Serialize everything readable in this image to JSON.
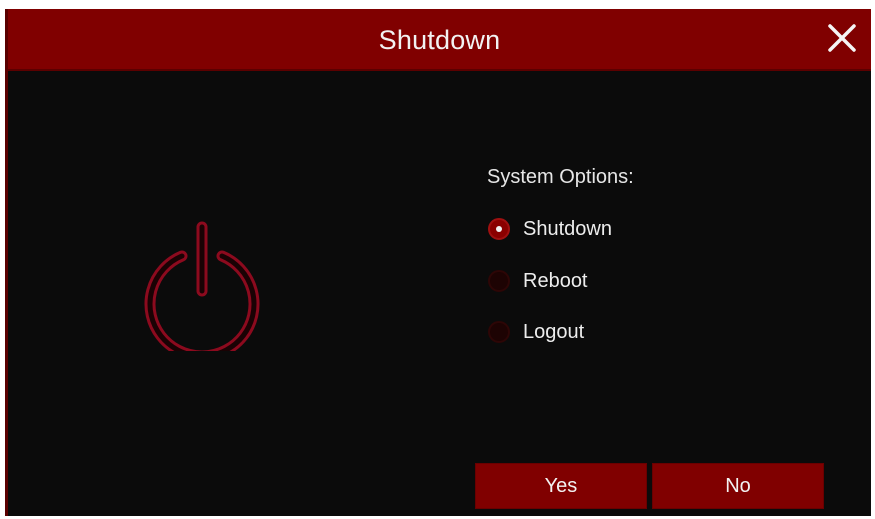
{
  "dialog": {
    "title": "Shutdown"
  },
  "options": {
    "label": "System Options:",
    "items": [
      {
        "label": "Shutdown",
        "selected": true
      },
      {
        "label": "Reboot",
        "selected": false
      },
      {
        "label": "Logout",
        "selected": false
      }
    ]
  },
  "buttons": {
    "yes_label": "Yes",
    "no_label": "No"
  },
  "colors": {
    "titlebar": "#800000",
    "background": "#0b0b0b",
    "button": "#800000",
    "radio_selected": "#8a0000",
    "power_icon": "#8c0a1e"
  },
  "icons": {
    "close": "close-icon",
    "power": "power-icon"
  }
}
